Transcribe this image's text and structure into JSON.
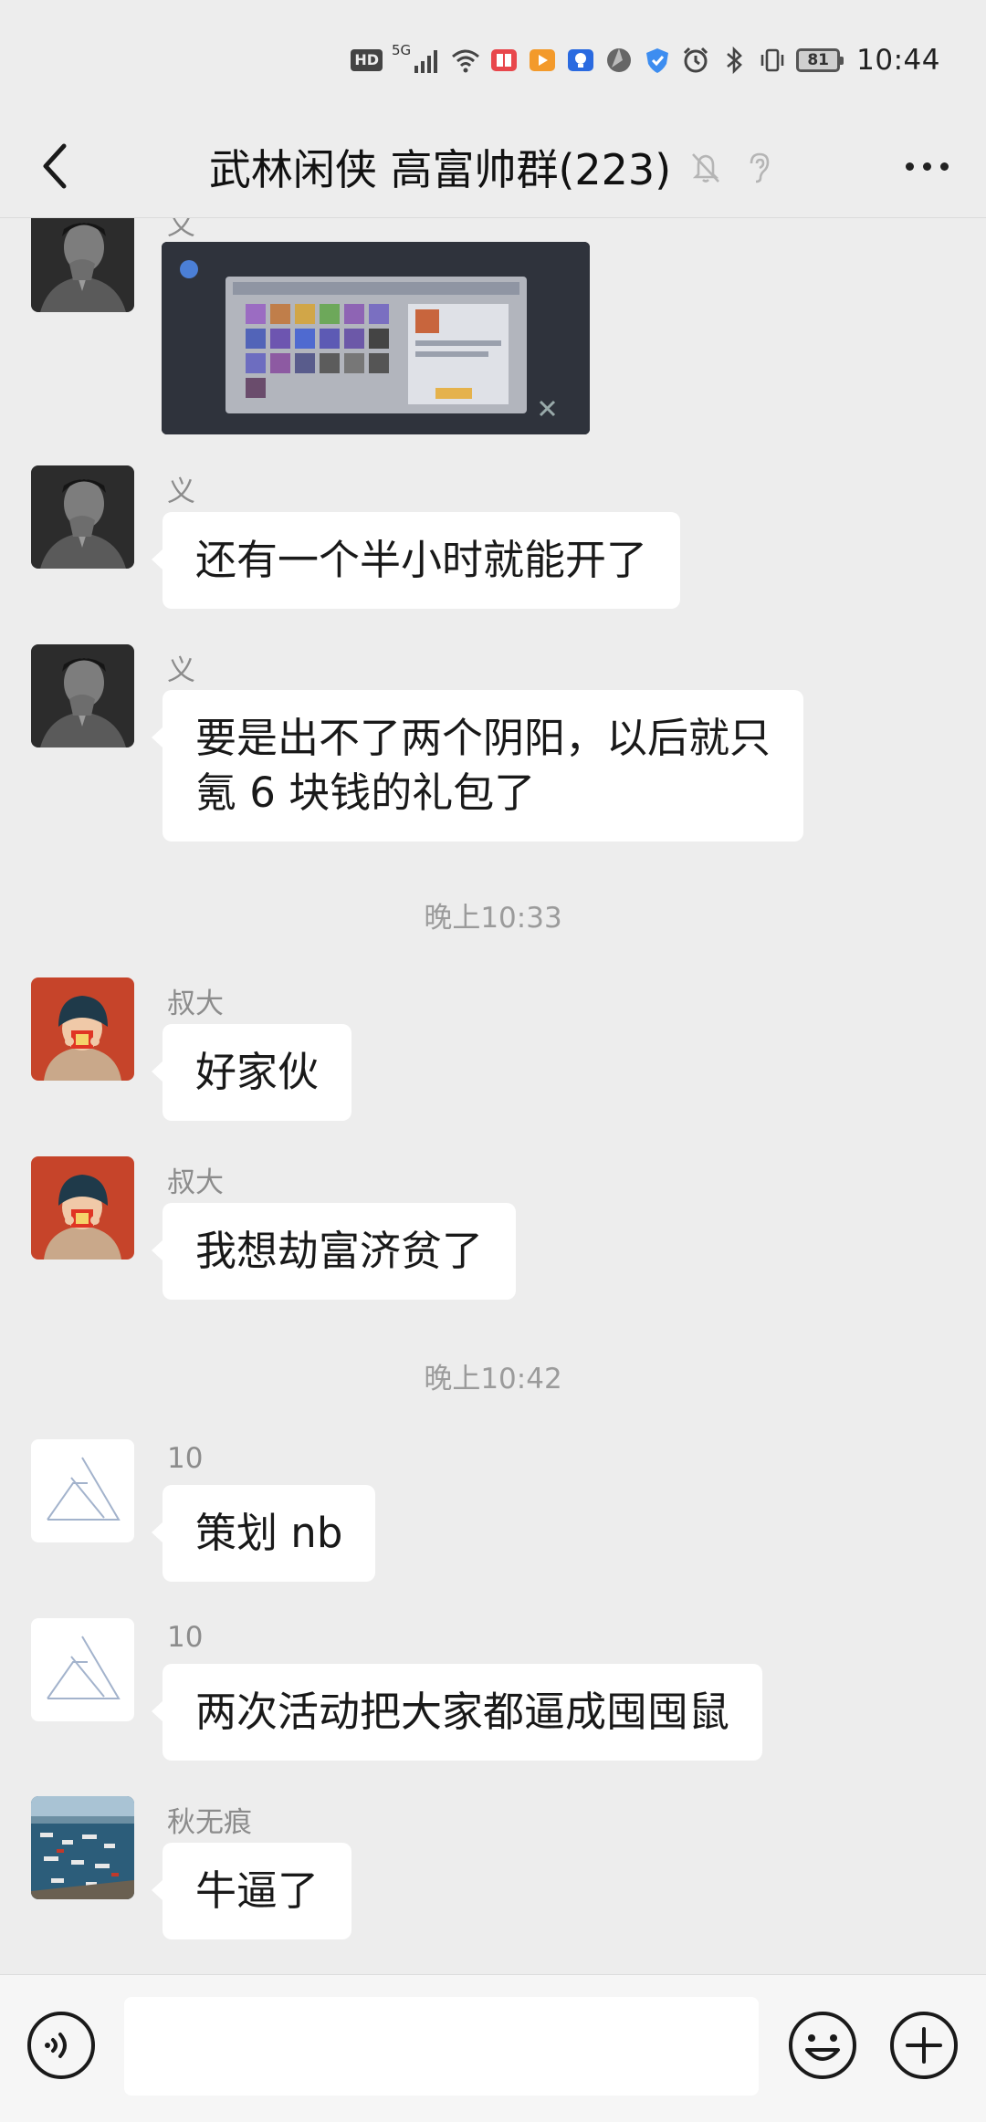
{
  "status_bar": {
    "hd": "HD",
    "network": "5G",
    "battery": "81",
    "time": "10:44",
    "icons": [
      "hd-icon",
      "signal-icon",
      "wifi-icon",
      "notification-app-icons",
      "alarm-icon",
      "bluetooth-icon",
      "vibrate-icon",
      "battery-icon"
    ]
  },
  "nav": {
    "title": "武林闲侠 高富帅群(223)",
    "back_icon": "chevron-left-icon",
    "muted_icon": "bell-muted-icon",
    "earpiece_icon": "ear-icon",
    "more_icon": "more-dots-icon"
  },
  "messages": [
    {
      "sender": "义",
      "type": "image",
      "avatar": "man-portrait"
    },
    {
      "sender": "义",
      "text": "还有一个半小时就能开了",
      "avatar": "man-portrait"
    },
    {
      "sender": "义",
      "text": "要是出不了两个阴阳，以后就只\n氪 6 块钱的礼包了",
      "avatar": "man-portrait"
    },
    {
      "timestamp": "晚上10:33"
    },
    {
      "sender": "叔大",
      "text": "好家伙",
      "avatar": "red-hat-girl"
    },
    {
      "sender": "叔大",
      "text": "我想劫富济贫了",
      "avatar": "red-hat-girl"
    },
    {
      "timestamp": "晚上10:42"
    },
    {
      "sender": "10",
      "text": "策划 nb",
      "avatar": "triangle-logo"
    },
    {
      "sender": "10",
      "text": "两次活动把大家都逼成囤囤鼠",
      "avatar": "triangle-logo"
    },
    {
      "sender": "秋无痕",
      "text": "牛逼了",
      "avatar": "harbor-photo"
    }
  ],
  "input_bar": {
    "voice_icon": "voice-icon",
    "input_value": "",
    "emoji_icon": "emoji-icon",
    "plus_icon": "plus-icon"
  },
  "colors": {
    "background": "#ededed",
    "bubble": "#ffffff",
    "secondary_text": "#8c8c8c"
  }
}
